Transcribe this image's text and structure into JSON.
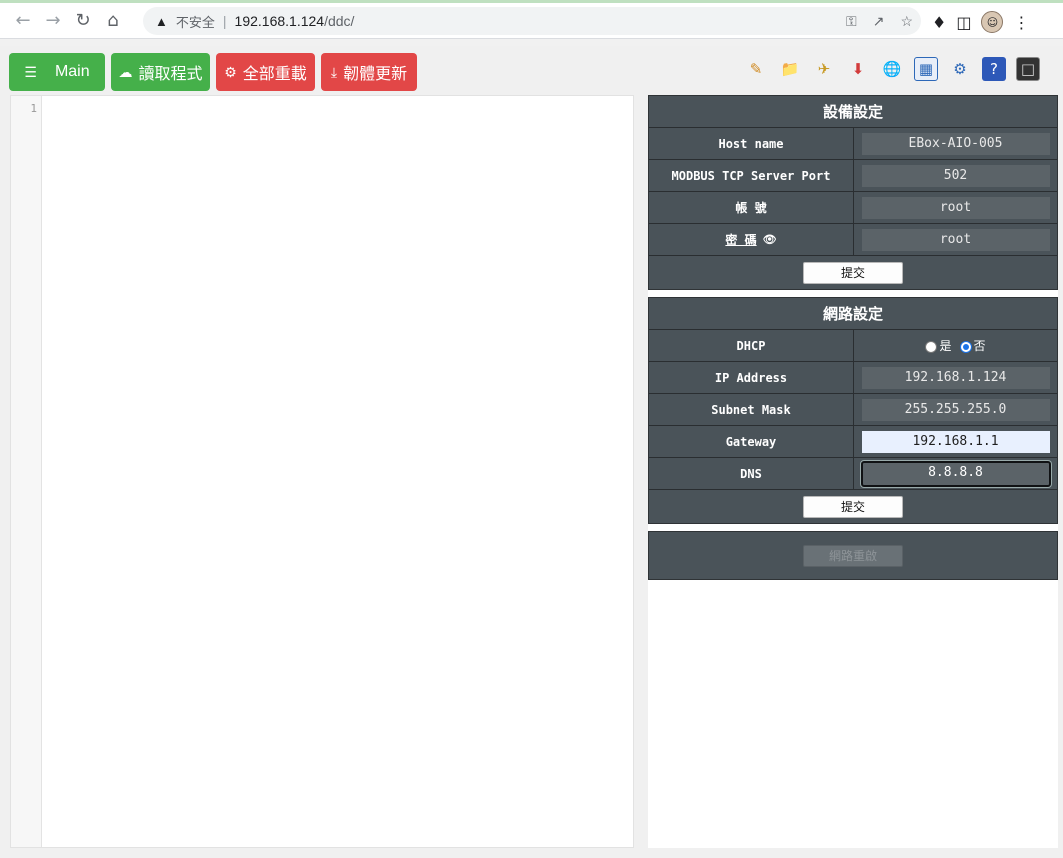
{
  "browser": {
    "back_icon": "arrow-left-icon",
    "forward_icon": "arrow-right-icon",
    "insecure_label": "不安全",
    "url_host": "192.168.1.124",
    "url_path": "/ddc/"
  },
  "toolbar": {
    "main_label": "Main",
    "read_label": "讀取程式",
    "reload_label": "全部重載",
    "firmware_label": "韌體更新",
    "colors": {
      "green": "#45b04a",
      "red": "#e24747"
    }
  },
  "editor": {
    "line_number": "1"
  },
  "device_settings": {
    "title": "設備設定",
    "host_label": "Host name",
    "host_value": "EBox-AIO-005",
    "port_label": "MODBUS TCP Server Port",
    "port_value": "502",
    "account_label": "帳 號",
    "account_value": "root",
    "password_label": "密 碼",
    "password_value": "root",
    "submit_label": "提交"
  },
  "network_settings": {
    "title": "網路設定",
    "dhcp_label": "DHCP",
    "dhcp_yes": "是",
    "dhcp_no": "否",
    "ip_label": "IP Address",
    "ip_value": "192.168.1.124",
    "mask_label": "Subnet Mask",
    "mask_value": "255.255.255.0",
    "gateway_label": "Gateway",
    "gateway_value": "192.168.1.1",
    "dns_label": "DNS",
    "dns_value": "8.8.8.8",
    "submit_label": "提交"
  },
  "network_restart": {
    "button_label": "網路重啟"
  }
}
